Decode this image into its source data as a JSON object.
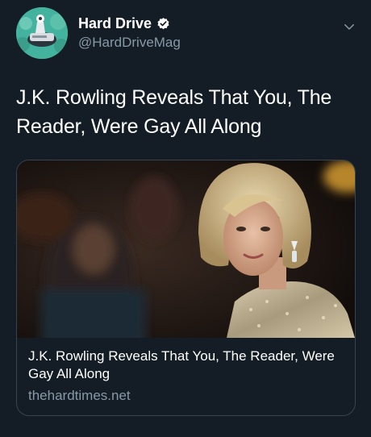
{
  "tweet": {
    "author": {
      "display_name": "Hard Drive",
      "handle": "@HardDriveMag",
      "verified_icon": "verified-badge-icon",
      "avatar_icon": "hard-drive-logo-avatar"
    },
    "menu_icon": "chevron-down-icon",
    "text": "J.K. Rowling Reveals That You, The Reader, Were Gay All Along"
  },
  "card": {
    "image": "photo-of-woman-in-sequined-dress",
    "title": "J.K. Rowling Reveals That You, The Reader, Were Gay All Along",
    "domain": "thehardtimes.net"
  },
  "colors": {
    "background": "#141d26",
    "text_primary": "#ffffff",
    "text_secondary": "#8899a6",
    "card_border": "#38444d",
    "verified": "#ffffff"
  }
}
